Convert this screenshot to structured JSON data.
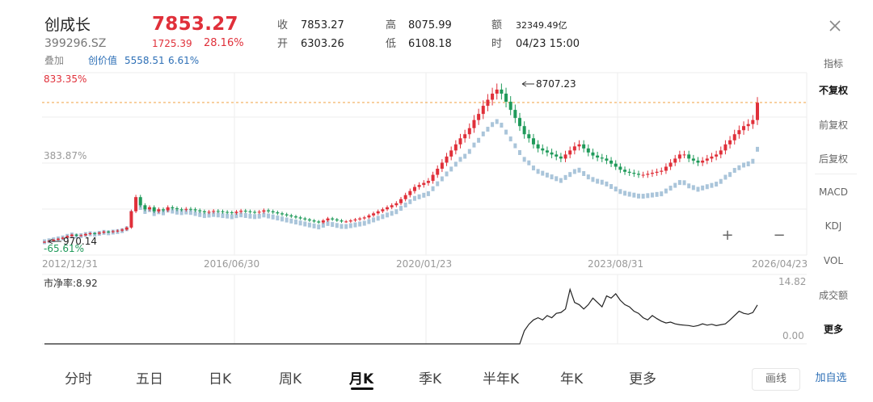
{
  "header": {
    "name": "创成长",
    "code": "399296.SZ",
    "price": "7853.27",
    "change": "1725.39",
    "change_pct": "28.16%",
    "overlay_label": "叠加",
    "overlay_item_label": "创价值",
    "overlay_item_value": "5558.51",
    "overlay_item_pct": "6.61%"
  },
  "quotes": {
    "close_label": "收",
    "close_value": "7853.27",
    "open_label": "开",
    "open_value": "6303.26",
    "high_label": "高",
    "high_value": "8075.99",
    "low_label": "低",
    "low_value": "6108.18",
    "amount_label": "额",
    "amount_value": "32349.49亿",
    "time_label": "时",
    "time_value": "04/23 15:00"
  },
  "main_chart": {
    "top_pct": "833.35%",
    "mid_pct": "383.87%",
    "bottom_pct": "-65.61%",
    "max_label": "8707.23",
    "min_label": "970.14"
  },
  "x_axis": {
    "labels": [
      "2012/12/31",
      "2016/06/30",
      "2020/01/23",
      "2023/08/31",
      "2026/04/23"
    ]
  },
  "sub_chart": {
    "title": "市净率:8.92",
    "top": "14.82",
    "bottom": "0.00"
  },
  "sidebar": {
    "items": [
      {
        "label": "指标"
      },
      {
        "label": "不复权"
      },
      {
        "label": "前复权"
      },
      {
        "label": "后复权"
      },
      {
        "label": "MACD"
      },
      {
        "label": "KDJ"
      },
      {
        "label": "VOL"
      },
      {
        "label": "成交额"
      },
      {
        "label": "更多"
      }
    ]
  },
  "tabs": [
    {
      "label": "分时"
    },
    {
      "label": "五日"
    },
    {
      "label": "日K"
    },
    {
      "label": "周K"
    },
    {
      "label": "月K"
    },
    {
      "label": "季K"
    },
    {
      "label": "半年K"
    },
    {
      "label": "年K"
    },
    {
      "label": "更多"
    }
  ],
  "buttons": {
    "draw_label": "画线",
    "watchlist_label": "加自选"
  },
  "colors": {
    "up": "#e0303a",
    "down": "#1f9a5a",
    "overlay": "#9bbbd3",
    "accent": "#2d6fb6"
  },
  "chart_data": {
    "type": "candlestick",
    "timeframe": "月K",
    "y_axis_scale": "percent change",
    "x_start": "2012/12/31",
    "x_end": "2026/04/23",
    "x_tick_labels": [
      "2012/12/31",
      "2016/06/30",
      "2020/01/23",
      "2023/08/31",
      "2026/04/23"
    ],
    "y_range_pct": [
      -65.61,
      833.35
    ],
    "reference_pct": 383.87,
    "annotated_high": 8707.23,
    "annotated_low": 970.14,
    "series": [
      {
        "name": "创成长",
        "approx_monthly_close": [
          1000,
          1050,
          1100,
          1150,
          1200,
          1280,
          1350,
          1300,
          1320,
          1380,
          1420,
          1400,
          1450,
          1500,
          1480,
          1520,
          1550,
          1600,
          1700,
          2500,
          3200,
          2800,
          2600,
          2700,
          2500,
          2600,
          2550,
          2700,
          2650,
          2600,
          2580,
          2620,
          2600,
          2550,
          2500,
          2450,
          2480,
          2520,
          2500,
          2470,
          2450,
          2420,
          2480,
          2530,
          2500,
          2470,
          2450,
          2480,
          2550,
          2500,
          2450,
          2400,
          2350,
          2300,
          2250,
          2200,
          2150,
          2100,
          2050,
          2000,
          1950,
          2050,
          2150,
          2100,
          2050,
          2000,
          2000,
          2050,
          2100,
          2150,
          2200,
          2300,
          2400,
          2500,
          2600,
          2700,
          2800,
          2900,
          3100,
          3300,
          3500,
          3700,
          3800,
          3900,
          4000,
          4300,
          4600,
          4900,
          5200,
          5500,
          5800,
          6100,
          6300,
          6600,
          7000,
          7300,
          7700,
          8000,
          8300,
          8500,
          8300,
          7900,
          7500,
          7100,
          6700,
          6300,
          6100,
          5800,
          5600,
          5500,
          5400,
          5300,
          5200,
          5100,
          5300,
          5500,
          5700,
          5800,
          5600,
          5400,
          5250,
          5150,
          5100,
          5000,
          4850,
          4700,
          4550,
          4450,
          4400,
          4350,
          4300,
          4300,
          4350,
          4400,
          4450,
          4500,
          4700,
          4900,
          5100,
          5300,
          5300,
          5100,
          5000,
          4900,
          5000,
          5100,
          5200,
          5300,
          5500,
          5800,
          6000,
          6300,
          6500,
          6700,
          6800,
          7000,
          7853.27
        ]
      },
      {
        "name": "创价值",
        "approx_start": 1000,
        "approx_end": 5558.51
      }
    ],
    "sub_chart": {
      "name": "市净率",
      "current": 8.92,
      "y_range": [
        0.0,
        14.82
      ],
      "approx_values_from_2019": [
        3.0,
        4.5,
        5.5,
        6.0,
        5.5,
        6.5,
        6.0,
        7.0,
        7.2,
        8.0,
        12.5,
        9.5,
        9.0,
        8.0,
        9.0,
        10.5,
        9.5,
        8.5,
        11.0,
        10.5,
        11.5,
        10.0,
        9.0,
        8.5,
        7.5,
        7.0,
        6.0,
        5.5,
        6.5,
        5.8,
        5.2,
        4.8,
        5.0,
        4.6,
        4.4,
        4.3,
        4.2,
        4.0,
        4.2,
        4.6,
        4.3,
        4.5,
        4.2,
        4.4,
        4.6,
        5.5,
        6.5,
        7.5,
        7.0,
        6.8,
        7.2,
        8.92
      ]
    }
  }
}
